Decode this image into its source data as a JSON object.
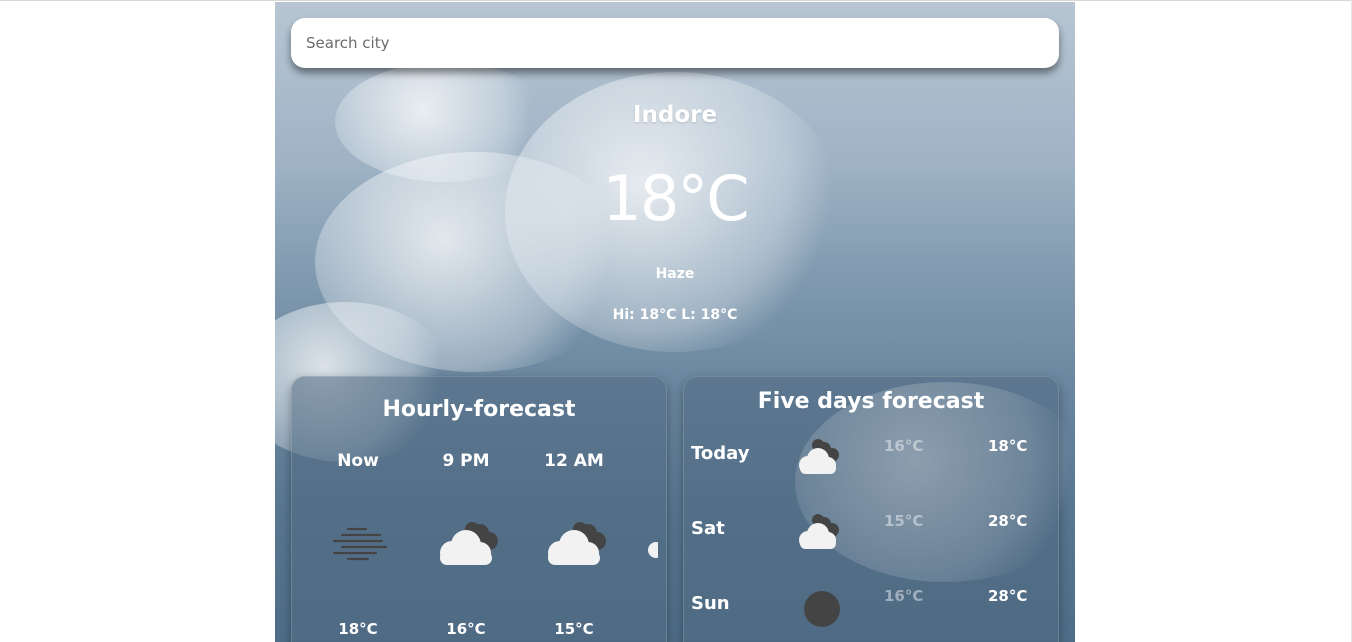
{
  "search": {
    "placeholder": "Search city"
  },
  "current": {
    "city": "Indore",
    "temperature": "18°C",
    "condition": "Haze",
    "hi_lo": "Hi: 18°C L: 18°C"
  },
  "hourly": {
    "title": "Hourly-forecast",
    "items": [
      {
        "time": "Now",
        "icon": "haze-icon",
        "temp": "18°C"
      },
      {
        "time": "9 PM",
        "icon": "cloudy-night-icon",
        "temp": "16°C"
      },
      {
        "time": "12 AM",
        "icon": "cloudy-night-icon",
        "temp": "15°C"
      }
    ]
  },
  "daily": {
    "title": "Five days forecast",
    "items": [
      {
        "day": "Today",
        "icon": "cloudy-icon",
        "low": "16°C",
        "high": "18°C"
      },
      {
        "day": "Sat",
        "icon": "cloudy-icon",
        "low": "15°C",
        "high": "28°C"
      },
      {
        "day": "Sun",
        "icon": "moon-icon",
        "low": "16°C",
        "high": "28°C"
      }
    ]
  },
  "colors": {
    "panel_bg": "#50698296",
    "icon_dark": "#444444",
    "cloud_white": "#f2f2f2"
  }
}
